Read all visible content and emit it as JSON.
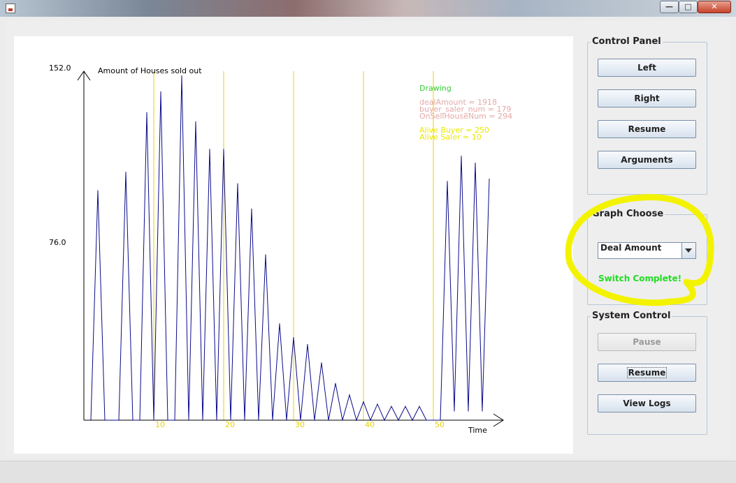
{
  "window": {
    "min_label": "—",
    "max_label": "□",
    "close_label": "✕"
  },
  "chart_data": {
    "type": "line",
    "ylabel": "Amount of Houses sold out",
    "xlabel": "Time",
    "y_ticks": [
      "152.0",
      "76.0"
    ],
    "x_ticks": [
      "10",
      "20",
      "30",
      "40",
      "50"
    ],
    "ylim": [
      0,
      152
    ],
    "xlim": [
      0,
      60
    ],
    "grid": "vertical lines every 10 time units",
    "series": [
      {
        "color": "#0a0a8a",
        "points": [
          [
            1,
            0
          ],
          [
            2,
            100
          ],
          [
            3,
            0
          ],
          [
            4,
            0
          ],
          [
            5,
            0
          ],
          [
            6,
            108
          ],
          [
            7,
            0
          ],
          [
            8,
            0
          ],
          [
            9,
            134
          ],
          [
            10,
            0
          ],
          [
            11,
            143
          ],
          [
            12,
            0
          ],
          [
            13,
            0
          ],
          [
            14,
            150
          ],
          [
            15,
            0
          ],
          [
            16,
            130
          ],
          [
            17,
            0
          ],
          [
            18,
            118
          ],
          [
            19,
            0
          ],
          [
            20,
            118
          ],
          [
            21,
            0
          ],
          [
            22,
            103
          ],
          [
            23,
            0
          ],
          [
            24,
            92
          ],
          [
            25,
            0
          ],
          [
            26,
            72
          ],
          [
            27,
            0
          ],
          [
            28,
            42
          ],
          [
            29,
            0
          ],
          [
            30,
            36
          ],
          [
            31,
            0
          ],
          [
            32,
            33
          ],
          [
            33,
            0
          ],
          [
            34,
            25
          ],
          [
            35,
            0
          ],
          [
            36,
            16
          ],
          [
            37,
            0
          ],
          [
            38,
            11
          ],
          [
            39,
            0
          ],
          [
            40,
            8
          ],
          [
            41,
            0
          ],
          [
            42,
            7
          ],
          [
            43,
            0
          ],
          [
            44,
            6
          ],
          [
            45,
            0
          ],
          [
            46,
            6
          ],
          [
            47,
            0
          ],
          [
            48,
            6
          ],
          [
            49,
            0
          ],
          [
            50,
            0
          ],
          [
            51,
            0
          ],
          [
            52,
            104
          ],
          [
            53,
            4
          ],
          [
            54,
            115
          ],
          [
            55,
            4
          ],
          [
            56,
            112
          ],
          [
            57,
            4
          ],
          [
            58,
            105
          ]
        ]
      }
    ]
  },
  "overlay": {
    "status_title": "Drawing",
    "stats": [
      "dealAmount = 1918",
      "buyer_saler_num = 179",
      "OnSellHouseNum = 294"
    ],
    "alive": [
      "Alive Buyer = 250",
      "Alive Saler = 10"
    ],
    "colors": {
      "status": "#33cc33",
      "stats": "#e6a8a8",
      "alive": "#e8e800",
      "grid": "#e8d000"
    }
  },
  "control_panel": {
    "title": "Control Panel",
    "buttons": [
      "Left",
      "Right",
      "Resume",
      "Arguments"
    ]
  },
  "graph_choose": {
    "title": "Graph Choose",
    "selected": "Deal Amount",
    "message": "Switch Complete!"
  },
  "system_control": {
    "title": "System Control",
    "buttons": [
      "Pause",
      "Resume",
      "View Logs"
    ]
  }
}
